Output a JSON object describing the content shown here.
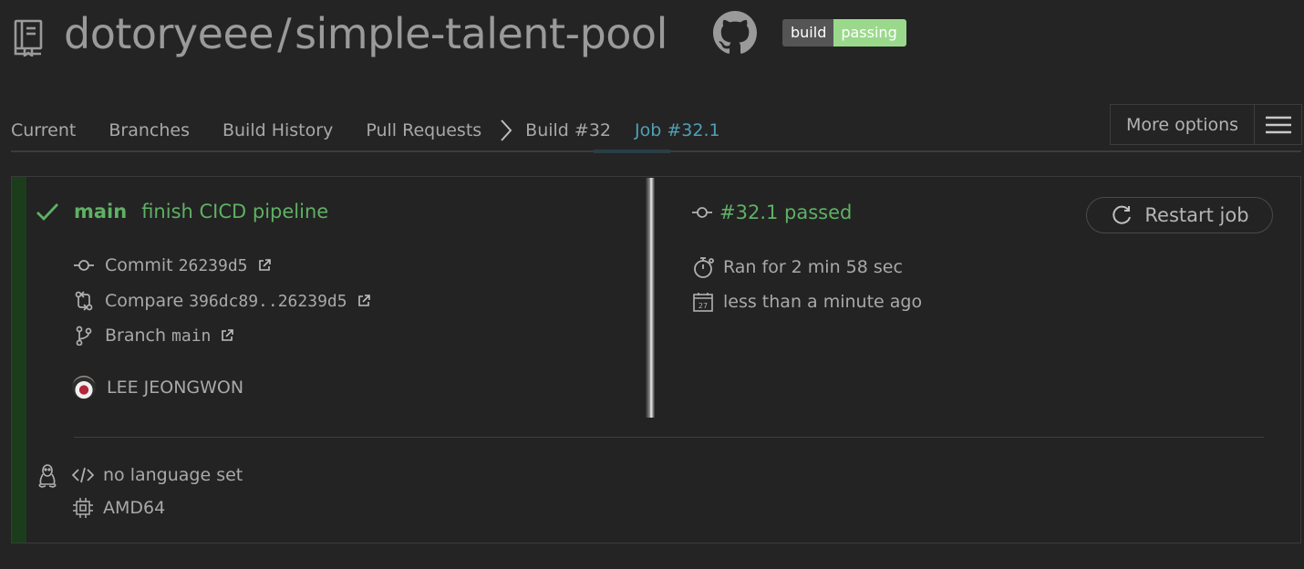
{
  "header": {
    "owner": "dotoryeee",
    "separator": "/",
    "repo": "simple-talent-pool",
    "badge": {
      "label": "build",
      "status": "passing"
    }
  },
  "nav": {
    "tabs": [
      "Current",
      "Branches",
      "Build History",
      "Pull Requests"
    ],
    "build": "Build #32",
    "job": "Job #32.1",
    "more_options": "More options"
  },
  "job": {
    "branch": "main",
    "message": "finish CICD pipeline",
    "commit_label": "Commit",
    "commit_hash": "26239d5",
    "compare_label": "Compare",
    "compare_range": "396dc89..26239d5",
    "branch_label": "Branch",
    "branch_name": "main",
    "author": "LEE JEONGWON",
    "status": "#32.1 passed",
    "duration": "Ran for 2 min 58 sec",
    "finished": "less than a minute ago",
    "restart_label": "Restart job",
    "language": "no language set",
    "arch": "AMD64"
  },
  "colors": {
    "background": "#242424",
    "passed_green": "#5fb065",
    "active_tab": "#4fa0b5",
    "badge_passing": "#9ad98b",
    "badge_label": "#555555"
  }
}
